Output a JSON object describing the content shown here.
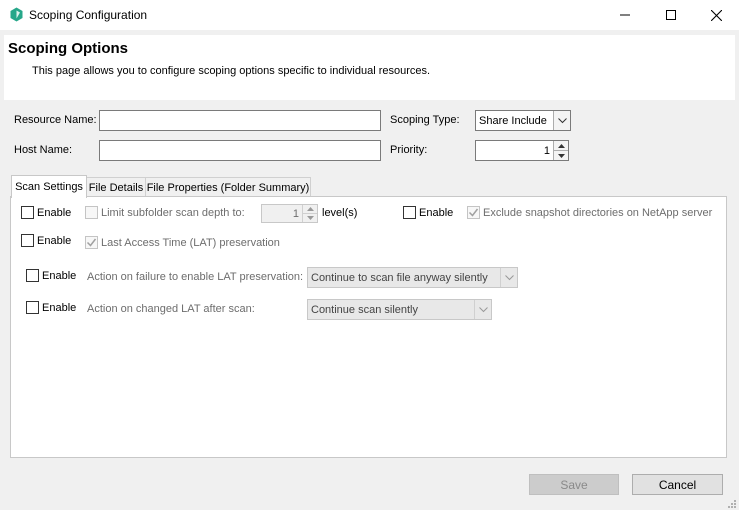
{
  "window": {
    "title": "Scoping Configuration",
    "icon": "app-hexagon-icon",
    "accent_color": "#27a78a"
  },
  "header": {
    "title": "Scoping Options",
    "description": "This page allows you to configure scoping options specific to individual resources."
  },
  "form": {
    "resource_name_label": "Resource Name:",
    "resource_name_value": "",
    "host_name_label": "Host Name:",
    "host_name_value": "",
    "scoping_type_label": "Scoping Type:",
    "scoping_type_value": "Share Include",
    "priority_label": "Priority:",
    "priority_value": "1"
  },
  "tabs": [
    {
      "label": "Scan Settings",
      "active": true
    },
    {
      "label": "File Details",
      "active": false
    },
    {
      "label": "File Properties (Folder Summary)",
      "active": false
    }
  ],
  "scan_settings": {
    "enable_label": "Enable",
    "subfolder_depth_label": "Limit subfolder scan depth to:",
    "subfolder_depth_value": "1",
    "levels_label": "level(s)",
    "snapshot_label": "Exclude snapshot directories on NetApp server",
    "lat_label": "Last Access Time (LAT) preservation",
    "lat_failure_label": "Action on failure to enable LAT preservation:",
    "lat_failure_value": "Continue to scan file anyway silently",
    "lat_changed_label": "Action on changed LAT after scan:",
    "lat_changed_value": "Continue scan silently"
  },
  "buttons": {
    "save": "Save",
    "cancel": "Cancel"
  }
}
